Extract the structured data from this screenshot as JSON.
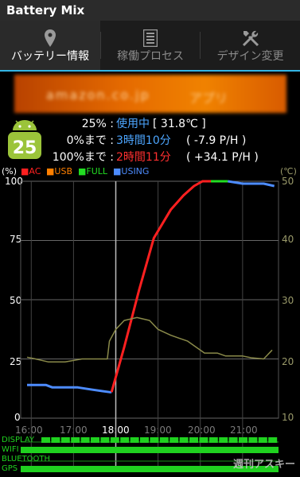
{
  "app": {
    "title": "Battery Mix"
  },
  "tabs": [
    {
      "label": "バッテリー情報",
      "icon": "location-pin-icon",
      "active": true
    },
    {
      "label": "稼働プロセス",
      "icon": "process-list-icon",
      "active": false
    },
    {
      "label": "デザイン変更",
      "icon": "tools-icon",
      "active": false
    }
  ],
  "battery": {
    "level": "25",
    "percent_label": "25% :",
    "status": "使用中",
    "temperature": "[ 31.8℃ ]",
    "empty_label": "0%まで :",
    "empty_time": "3時間10分",
    "empty_rate": "( -7.9 P/H )",
    "full_label": "100%まで :",
    "full_time": "2時間11分",
    "full_rate": "( +34.1 P/H )"
  },
  "legend": {
    "y_unit_left": "(%)",
    "y_unit_right": "(℃)",
    "items": [
      {
        "label": "AC",
        "color": "#ff2020"
      },
      {
        "label": "USB",
        "color": "#ff8000"
      },
      {
        "label": "FULL",
        "color": "#22dd22"
      },
      {
        "label": "USING",
        "color": "#4d8cff"
      }
    ]
  },
  "chart_data": {
    "type": "line",
    "x_ticks": [
      "16:00",
      "17:00",
      "18:00",
      "19:00",
      "20:00",
      "21:00"
    ],
    "y_left_ticks": [
      "100",
      "75",
      "50",
      "25",
      "0"
    ],
    "y_right_ticks": [
      "50",
      "40",
      "30",
      "20",
      "10"
    ],
    "ylim": [
      0,
      100
    ],
    "y2lim": [
      10,
      50
    ],
    "series": [
      {
        "name": "USING",
        "color": "#4d8cff",
        "axis": "left",
        "points": [
          [
            15.9,
            14
          ],
          [
            16.35,
            14
          ],
          [
            16.5,
            13
          ],
          [
            17.1,
            13
          ],
          [
            17.45,
            12
          ],
          [
            17.85,
            11
          ],
          [
            17.9,
            11
          ]
        ]
      },
      {
        "name": "AC",
        "color": "#ff2020",
        "axis": "left",
        "points": [
          [
            17.9,
            11
          ],
          [
            18.2,
            30
          ],
          [
            18.55,
            54
          ],
          [
            18.9,
            76
          ],
          [
            19.3,
            88
          ],
          [
            19.6,
            94
          ],
          [
            19.85,
            98
          ],
          [
            20.05,
            100
          ],
          [
            20.25,
            100
          ]
        ]
      },
      {
        "name": "FULL",
        "color": "#22dd22",
        "axis": "left",
        "points": [
          [
            20.25,
            100
          ],
          [
            20.65,
            100
          ]
        ]
      },
      {
        "name": "USING",
        "color": "#4d8cff",
        "axis": "left",
        "points": [
          [
            20.65,
            100
          ],
          [
            21.0,
            99
          ],
          [
            21.5,
            99
          ],
          [
            21.75,
            98
          ]
        ]
      },
      {
        "name": "temperature",
        "color": "#8a8a4a",
        "axis": "right",
        "points": [
          [
            15.9,
            20.3
          ],
          [
            16.1,
            20
          ],
          [
            16.4,
            19.5
          ],
          [
            16.8,
            19.5
          ],
          [
            17.2,
            20
          ],
          [
            17.5,
            20
          ],
          [
            17.8,
            20
          ],
          [
            17.85,
            23
          ],
          [
            18.0,
            25
          ],
          [
            18.2,
            26.5
          ],
          [
            18.5,
            27
          ],
          [
            18.8,
            26.5
          ],
          [
            19.0,
            25
          ],
          [
            19.3,
            24
          ],
          [
            19.5,
            23.5
          ],
          [
            19.7,
            23
          ],
          [
            19.9,
            22
          ],
          [
            20.1,
            21
          ],
          [
            20.4,
            21
          ],
          [
            20.6,
            20.5
          ],
          [
            20.8,
            20.5
          ],
          [
            21.0,
            20.5
          ],
          [
            21.2,
            20.2
          ],
          [
            21.5,
            20
          ],
          [
            21.7,
            21.5
          ]
        ]
      }
    ]
  },
  "status_rows": [
    {
      "label": "DISPLAY",
      "fill": 1.0,
      "segmented": true
    },
    {
      "label": "WIFI",
      "fill": 1.0
    },
    {
      "label": "BLUETOOTH",
      "fill": 0.0
    },
    {
      "label": "GPS",
      "fill": 1.0
    }
  ],
  "watermark": "週刊アスキー"
}
